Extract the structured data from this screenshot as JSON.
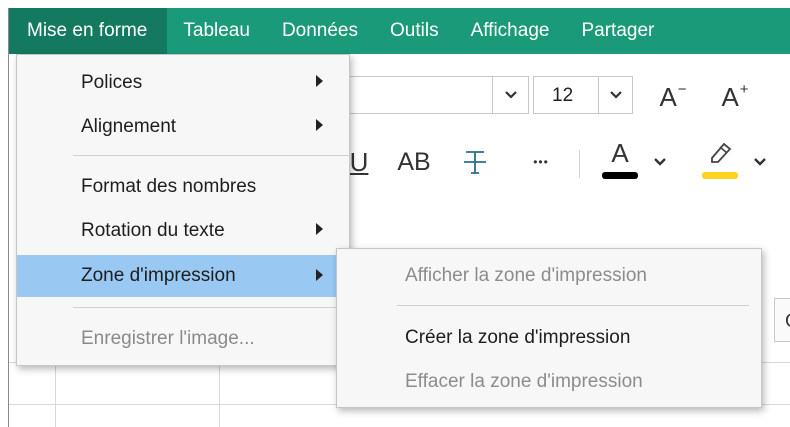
{
  "menubar": {
    "items": [
      {
        "label": "Mise en forme",
        "active": true
      },
      {
        "label": "Tableau"
      },
      {
        "label": "Données"
      },
      {
        "label": "Outils"
      },
      {
        "label": "Affichage"
      },
      {
        "label": "Partager"
      }
    ],
    "bg_color": "#1a9a78",
    "active_color": "#137a5f"
  },
  "toolbar": {
    "font_size_value": "12",
    "decrease_font_label": "A",
    "decrease_font_suffix": "−",
    "increase_font_label": "A",
    "increase_font_suffix": "+",
    "underline_label": "U",
    "caps_label": "AB",
    "more_label": "•••",
    "text_color_label": "A",
    "text_color": "#000000",
    "highlight_color": "#ffd21f"
  },
  "dropdown": {
    "items": [
      {
        "label": "Polices",
        "submenu": true
      },
      {
        "label": "Alignement",
        "submenu": true
      },
      {
        "label": "Format des nombres"
      },
      {
        "label": "Rotation du texte",
        "submenu": true
      },
      {
        "label": "Zone d'impression",
        "submenu": true,
        "highlighted": true
      },
      {
        "label": "Enregistrer l'image...",
        "disabled": true
      }
    ],
    "highlight_color": "#99c8f2"
  },
  "submenu": {
    "items": [
      {
        "label": "Afficher la zone d'impression",
        "disabled": true
      },
      {
        "label": "Créer la zone d'impression"
      },
      {
        "label": "Effacer la zone d'impression",
        "disabled": true
      }
    ]
  },
  "sheet": {
    "column_header_partial": "G"
  }
}
